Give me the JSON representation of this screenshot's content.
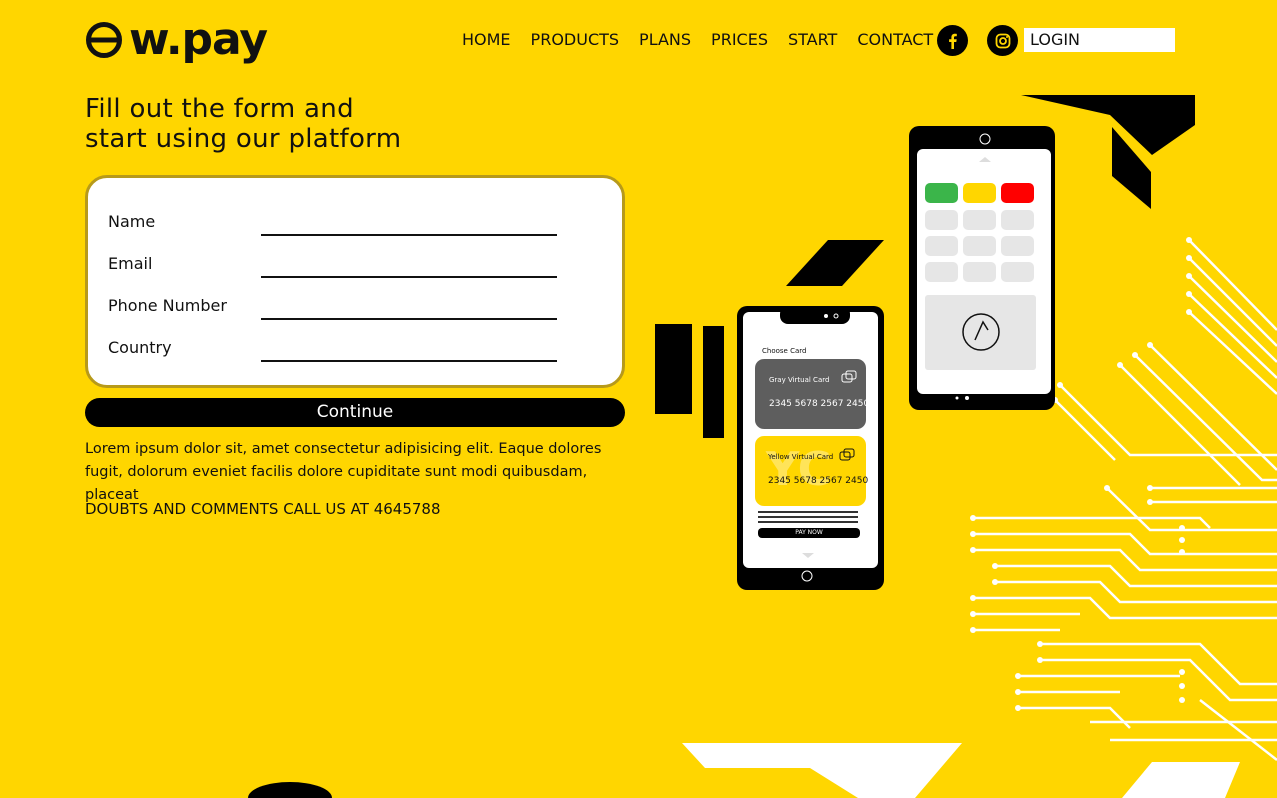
{
  "brand": {
    "logo_text": "w.pay"
  },
  "nav": {
    "items": [
      "HOME",
      "PRODUCTS",
      "PLANS",
      "PRICES",
      "START",
      "CONTACT"
    ]
  },
  "social": {
    "facebook_icon": "facebook-icon",
    "instagram_icon": "instagram-icon"
  },
  "login": {
    "label": "LOGIN"
  },
  "hero": {
    "headline_line1": "Fill out the form and",
    "headline_line2": "start using our platform"
  },
  "form": {
    "fields": [
      {
        "label": "Name",
        "value": ""
      },
      {
        "label": "Email",
        "value": ""
      },
      {
        "label": "Phone Number",
        "value": ""
      },
      {
        "label": "Country",
        "value": ""
      }
    ],
    "submit_label": "Continue"
  },
  "description": "Lorem ipsum dolor sit, amet consectetur adipisicing elit. Eaque dolores fugit, dolorum eveniet facilis dolore cupiditate sunt modi quibusdam, placeat",
  "contact_note": "DOUBTS AND COMMENTS CALL US AT 4645788",
  "phone_front": {
    "heading": "Choose Card",
    "gray_card_title": "Gray Virtual Card",
    "gray_card_number": "2345 5678 2567 2450",
    "yellow_card_title": "Yellow Virtual Card",
    "yellow_card_number": "2345 5678 2567 2450",
    "yellow_card_watermark": "YC",
    "pay_button": "PAY NOW"
  },
  "colors": {
    "background": "#FFD600",
    "dark": "#000000",
    "green": "#3BB54A",
    "red": "#FF0000",
    "yellow_key": "#FFD600"
  }
}
